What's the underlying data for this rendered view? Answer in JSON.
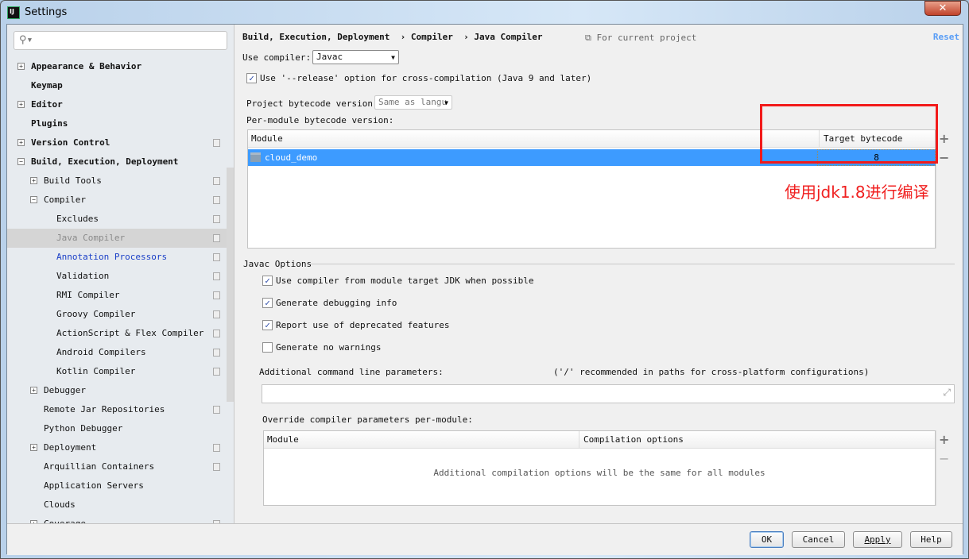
{
  "window": {
    "title": "Settings",
    "close_label": "✕"
  },
  "search": {
    "icon": "search-icon",
    "placeholder": ""
  },
  "sidebar": {
    "items": [
      {
        "label": "Appearance & Behavior",
        "level": 0,
        "expander": "+",
        "bold": true
      },
      {
        "label": "Keymap",
        "level": 0,
        "bold": true
      },
      {
        "label": "Editor",
        "level": 0,
        "expander": "+",
        "bold": true
      },
      {
        "label": "Plugins",
        "level": 0,
        "bold": true
      },
      {
        "label": "Version Control",
        "level": 0,
        "expander": "+",
        "bold": true,
        "project": true
      },
      {
        "label": "Build, Execution, Deployment",
        "level": 0,
        "expander": "−",
        "bold": true
      },
      {
        "label": "Build Tools",
        "level": 1,
        "expander": "+",
        "project": true
      },
      {
        "label": "Compiler",
        "level": 1,
        "expander": "−",
        "project": true
      },
      {
        "label": "Excludes",
        "level": 2,
        "project": true
      },
      {
        "label": "Java Compiler",
        "level": 2,
        "project": true,
        "selected": true
      },
      {
        "label": "Annotation Processors",
        "level": 2,
        "project": true,
        "link": true
      },
      {
        "label": "Validation",
        "level": 2,
        "project": true
      },
      {
        "label": "RMI Compiler",
        "level": 2,
        "project": true
      },
      {
        "label": "Groovy Compiler",
        "level": 2,
        "project": true
      },
      {
        "label": "ActionScript & Flex Compiler",
        "level": 2,
        "project": true
      },
      {
        "label": "Android Compilers",
        "level": 2,
        "project": true
      },
      {
        "label": "Kotlin Compiler",
        "level": 2,
        "project": true
      },
      {
        "label": "Debugger",
        "level": 1,
        "expander": "+"
      },
      {
        "label": "Remote Jar Repositories",
        "level": 1,
        "project": true
      },
      {
        "label": "Python Debugger",
        "level": 1
      },
      {
        "label": "Deployment",
        "level": 1,
        "expander": "+",
        "project": true
      },
      {
        "label": "Arquillian Containers",
        "level": 1,
        "project": true
      },
      {
        "label": "Application Servers",
        "level": 1
      },
      {
        "label": "Clouds",
        "level": 1
      },
      {
        "label": "Coverage",
        "level": 1,
        "expander": "+",
        "project": true
      }
    ]
  },
  "main": {
    "breadcrumb": "Build, Execution, Deployment  › Compiler  › Java Compiler",
    "for_current_project": "For current project",
    "reset": "Reset",
    "use_compiler_label": "Use compiler:",
    "use_compiler_value": "Javac",
    "release_option": {
      "label": "Use '--release' option for cross-compilation (Java 9 and later)",
      "checked": true
    },
    "project_bytecode_label": "Project bytecode version:",
    "project_bytecode_value": "Same as langu",
    "per_module_label": "Per-module bytecode version:",
    "module_table": {
      "headers": [
        "Module",
        "Target bytecode version"
      ],
      "rows": [
        {
          "module": "cloud_demo",
          "version": "8"
        }
      ]
    },
    "javac_options_title": "Javac Options",
    "options": [
      {
        "label": "Use compiler from module target JDK when possible",
        "checked": true
      },
      {
        "label": "Generate debugging info",
        "checked": true
      },
      {
        "label": "Report use of deprecated features",
        "checked": true
      },
      {
        "label": "Generate no warnings",
        "checked": false
      }
    ],
    "additional_params_label": "Additional command line parameters:",
    "additional_params_hint": "('/' recommended in paths for cross-platform configurations)",
    "additional_params_value": "",
    "override_label": "Override compiler parameters per-module:",
    "override_table": {
      "headers": [
        "Module",
        "Compilation options"
      ],
      "empty_text": "Additional compilation options will be the same for all modules"
    }
  },
  "annotation": {
    "text": "使用jdk1.8进行编译",
    "color": "#f21a1a"
  },
  "footer": {
    "ok": "OK",
    "cancel": "Cancel",
    "apply": "Apply",
    "help": "Help"
  },
  "colors": {
    "selection": "#3d9bff",
    "link": "#1a3fc7",
    "reset": "#589df6"
  }
}
